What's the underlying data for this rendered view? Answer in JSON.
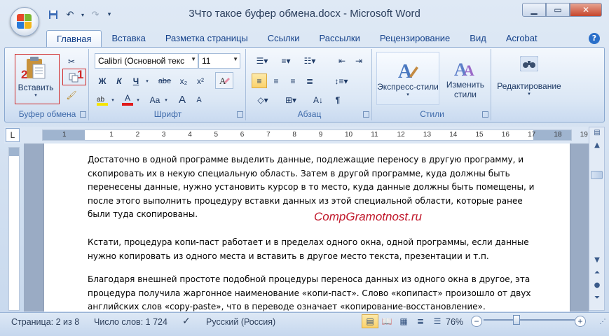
{
  "window": {
    "title": "3Что такое буфер обмена.docx - Microsoft Word",
    "controls": [
      "minimize-icon",
      "maximize-icon",
      "close-icon"
    ]
  },
  "qat": [
    "save-icon",
    "undo-icon",
    "redo-icon",
    "customize-icon"
  ],
  "tabs": [
    "Главная",
    "Вставка",
    "Разметка страницы",
    "Ссылки",
    "Рассылки",
    "Рецензирование",
    "Вид",
    "Acrobat"
  ],
  "ribbon": {
    "clipboard": {
      "label": "Буфер обмена",
      "paste": "Вставить",
      "annotation_paste": "2",
      "annotation_copy": "1"
    },
    "font": {
      "label": "Шрифт",
      "font_name": "Calibri (Основной текс",
      "font_size": "11",
      "bold": "Ж",
      "italic": "К",
      "underline": "Ч",
      "strike": "abe",
      "sub": "x₂",
      "sup": "x²",
      "grow": "A",
      "shrink": "A",
      "case": "Aa",
      "color": "A"
    },
    "paragraph": {
      "label": "Абзац",
      "pilcrow": "¶"
    },
    "styles": {
      "label": "Стили",
      "quick_styles": "Экспресс-стили",
      "change_styles": "Изменить",
      "change_styles2": "стили"
    },
    "editing": {
      "label": "Редактирование"
    }
  },
  "ruler": {
    "tab_selector": "L",
    "numbers": [
      "1",
      "1",
      "2",
      "3",
      "4",
      "5",
      "6",
      "7",
      "8",
      "9",
      "10",
      "11",
      "12",
      "13",
      "14",
      "15",
      "16",
      "17",
      "18",
      "19"
    ]
  },
  "document": {
    "p1": "Достаточно в одной программе выделить данные, подлежащие переносу в другую программу, и скопировать их в некую специальную область. Затем в другой программе, куда должны быть перенесены данные, нужно установить курсор в то место, куда данные должны быть помещены, и после этого выполнить процедуру вставки данных из этой специальной области, которые ранее были туда скопированы.",
    "watermark": "CompGramotnost.ru",
    "p2": "Кстати, процедура копи-паст работает и в пределах одного окна, одной программы, если данные нужно копировать из одного места и вставить в другое место текста, презентации и т.п.",
    "p3": "Благодаря внешней простоте подобной процедуры переноса данных из одного окна в другое, эта процедура получила жаргонное наименование «копи-паст». Слово «копипаст» произошло от двух английских слов «copy-paste», что в переводе означает «копирование-восстановление»."
  },
  "status": {
    "page": "Страница: 2 из 8",
    "words": "Число слов: 1 724",
    "language": "Русский (Россия)",
    "zoom": "76%"
  },
  "colors": {
    "accent": "#15428b",
    "annotation": "#d02a2a",
    "watermark": "#c0172a"
  }
}
